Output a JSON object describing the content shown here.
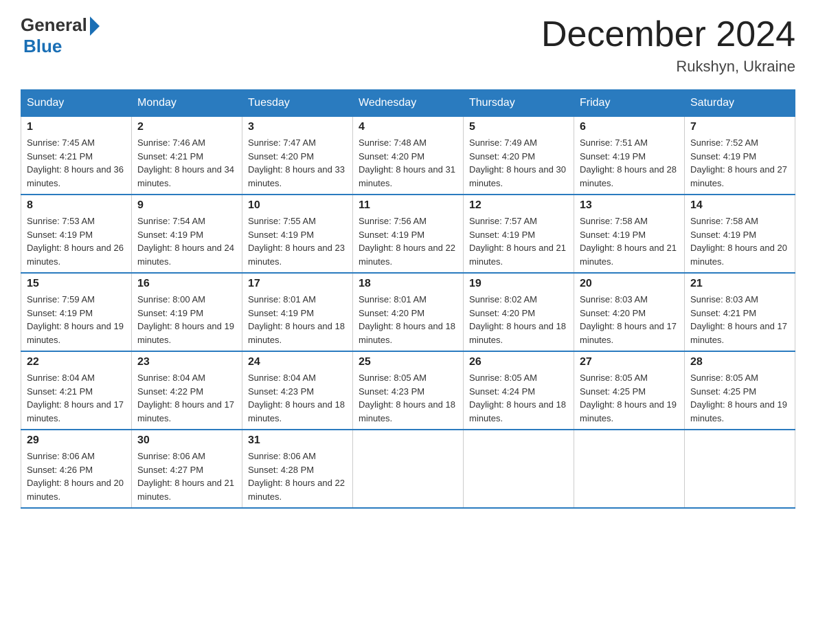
{
  "header": {
    "logo_general": "General",
    "logo_blue": "Blue",
    "title": "December 2024",
    "location": "Rukshyn, Ukraine"
  },
  "calendar": {
    "days_of_week": [
      "Sunday",
      "Monday",
      "Tuesday",
      "Wednesday",
      "Thursday",
      "Friday",
      "Saturday"
    ],
    "weeks": [
      [
        {
          "day": "1",
          "sunrise": "7:45 AM",
          "sunset": "4:21 PM",
          "daylight": "8 hours and 36 minutes."
        },
        {
          "day": "2",
          "sunrise": "7:46 AM",
          "sunset": "4:21 PM",
          "daylight": "8 hours and 34 minutes."
        },
        {
          "day": "3",
          "sunrise": "7:47 AM",
          "sunset": "4:20 PM",
          "daylight": "8 hours and 33 minutes."
        },
        {
          "day": "4",
          "sunrise": "7:48 AM",
          "sunset": "4:20 PM",
          "daylight": "8 hours and 31 minutes."
        },
        {
          "day": "5",
          "sunrise": "7:49 AM",
          "sunset": "4:20 PM",
          "daylight": "8 hours and 30 minutes."
        },
        {
          "day": "6",
          "sunrise": "7:51 AM",
          "sunset": "4:19 PM",
          "daylight": "8 hours and 28 minutes."
        },
        {
          "day": "7",
          "sunrise": "7:52 AM",
          "sunset": "4:19 PM",
          "daylight": "8 hours and 27 minutes."
        }
      ],
      [
        {
          "day": "8",
          "sunrise": "7:53 AM",
          "sunset": "4:19 PM",
          "daylight": "8 hours and 26 minutes."
        },
        {
          "day": "9",
          "sunrise": "7:54 AM",
          "sunset": "4:19 PM",
          "daylight": "8 hours and 24 minutes."
        },
        {
          "day": "10",
          "sunrise": "7:55 AM",
          "sunset": "4:19 PM",
          "daylight": "8 hours and 23 minutes."
        },
        {
          "day": "11",
          "sunrise": "7:56 AM",
          "sunset": "4:19 PM",
          "daylight": "8 hours and 22 minutes."
        },
        {
          "day": "12",
          "sunrise": "7:57 AM",
          "sunset": "4:19 PM",
          "daylight": "8 hours and 21 minutes."
        },
        {
          "day": "13",
          "sunrise": "7:58 AM",
          "sunset": "4:19 PM",
          "daylight": "8 hours and 21 minutes."
        },
        {
          "day": "14",
          "sunrise": "7:58 AM",
          "sunset": "4:19 PM",
          "daylight": "8 hours and 20 minutes."
        }
      ],
      [
        {
          "day": "15",
          "sunrise": "7:59 AM",
          "sunset": "4:19 PM",
          "daylight": "8 hours and 19 minutes."
        },
        {
          "day": "16",
          "sunrise": "8:00 AM",
          "sunset": "4:19 PM",
          "daylight": "8 hours and 19 minutes."
        },
        {
          "day": "17",
          "sunrise": "8:01 AM",
          "sunset": "4:19 PM",
          "daylight": "8 hours and 18 minutes."
        },
        {
          "day": "18",
          "sunrise": "8:01 AM",
          "sunset": "4:20 PM",
          "daylight": "8 hours and 18 minutes."
        },
        {
          "day": "19",
          "sunrise": "8:02 AM",
          "sunset": "4:20 PM",
          "daylight": "8 hours and 18 minutes."
        },
        {
          "day": "20",
          "sunrise": "8:03 AM",
          "sunset": "4:20 PM",
          "daylight": "8 hours and 17 minutes."
        },
        {
          "day": "21",
          "sunrise": "8:03 AM",
          "sunset": "4:21 PM",
          "daylight": "8 hours and 17 minutes."
        }
      ],
      [
        {
          "day": "22",
          "sunrise": "8:04 AM",
          "sunset": "4:21 PM",
          "daylight": "8 hours and 17 minutes."
        },
        {
          "day": "23",
          "sunrise": "8:04 AM",
          "sunset": "4:22 PM",
          "daylight": "8 hours and 17 minutes."
        },
        {
          "day": "24",
          "sunrise": "8:04 AM",
          "sunset": "4:23 PM",
          "daylight": "8 hours and 18 minutes."
        },
        {
          "day": "25",
          "sunrise": "8:05 AM",
          "sunset": "4:23 PM",
          "daylight": "8 hours and 18 minutes."
        },
        {
          "day": "26",
          "sunrise": "8:05 AM",
          "sunset": "4:24 PM",
          "daylight": "8 hours and 18 minutes."
        },
        {
          "day": "27",
          "sunrise": "8:05 AM",
          "sunset": "4:25 PM",
          "daylight": "8 hours and 19 minutes."
        },
        {
          "day": "28",
          "sunrise": "8:05 AM",
          "sunset": "4:25 PM",
          "daylight": "8 hours and 19 minutes."
        }
      ],
      [
        {
          "day": "29",
          "sunrise": "8:06 AM",
          "sunset": "4:26 PM",
          "daylight": "8 hours and 20 minutes."
        },
        {
          "day": "30",
          "sunrise": "8:06 AM",
          "sunset": "4:27 PM",
          "daylight": "8 hours and 21 minutes."
        },
        {
          "day": "31",
          "sunrise": "8:06 AM",
          "sunset": "4:28 PM",
          "daylight": "8 hours and 22 minutes."
        },
        null,
        null,
        null,
        null
      ]
    ]
  }
}
